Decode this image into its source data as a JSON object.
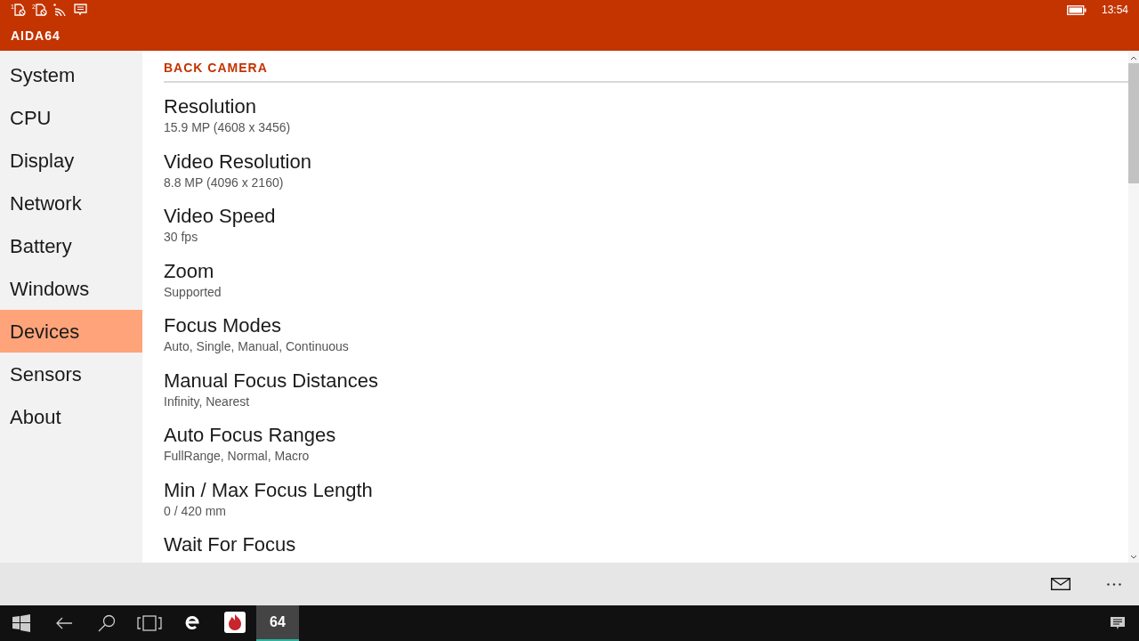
{
  "status_bar": {
    "sims": [
      {
        "label": "1"
      },
      {
        "label": "2"
      }
    ],
    "time": "13:54"
  },
  "app_title": "AIDA64",
  "sidebar": {
    "items": [
      {
        "label": "System",
        "selected": false
      },
      {
        "label": "CPU",
        "selected": false
      },
      {
        "label": "Display",
        "selected": false
      },
      {
        "label": "Network",
        "selected": false
      },
      {
        "label": "Battery",
        "selected": false
      },
      {
        "label": "Windows",
        "selected": false
      },
      {
        "label": "Devices",
        "selected": true
      },
      {
        "label": "Sensors",
        "selected": false
      },
      {
        "label": "About",
        "selected": false
      }
    ]
  },
  "section": {
    "title": "BACK CAMERA",
    "properties": [
      {
        "name": "Resolution",
        "value": "15.9 MP (4608 x 3456)"
      },
      {
        "name": "Video Resolution",
        "value": "8.8 MP (4096 x 2160)"
      },
      {
        "name": "Video Speed",
        "value": "30 fps"
      },
      {
        "name": "Zoom",
        "value": "Supported"
      },
      {
        "name": "Focus Modes",
        "value": "Auto, Single, Manual, Continuous"
      },
      {
        "name": "Manual Focus Distances",
        "value": "Infinity, Nearest"
      },
      {
        "name": "Auto Focus Ranges",
        "value": "FullRange, Normal, Macro"
      },
      {
        "name": "Min / Max Focus Length",
        "value": "0 / 420 mm"
      },
      {
        "name": "Wait For Focus"
      }
    ]
  },
  "taskbar": {
    "apps": [
      {
        "kind": "browser",
        "selected": false
      },
      {
        "kind": "benchmark",
        "selected": false
      },
      {
        "kind": "label",
        "label": "64",
        "selected": true
      }
    ]
  }
}
